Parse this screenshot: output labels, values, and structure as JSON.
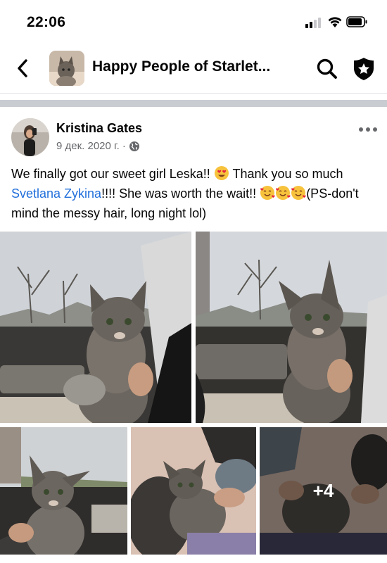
{
  "status_bar": {
    "time": "22:06"
  },
  "header": {
    "group_title": "Happy People of Starlet..."
  },
  "post": {
    "author": "Kristina Gates",
    "date": "9 дек. 2020 г.",
    "separator": "·",
    "text_1": "We finally got our sweet girl Leska!! ",
    "text_2": " Thank you so much ",
    "mention": "Svetlana Zykina",
    "text_3": "!!!! She was worth the wait!! ",
    "text_4": "(PS-don't mind the messy hair, long night lol)",
    "more_photos": "+4"
  },
  "colors": {
    "text": "#050505",
    "secondary": "#65676b",
    "link": "#216fdb",
    "divider": "#c9ccd1"
  },
  "icons": [
    "back-icon",
    "search-icon",
    "shield-star-icon",
    "globe-icon",
    "more-icon",
    "heart-eyes-emoji",
    "smiling-hearts-emoji"
  ]
}
